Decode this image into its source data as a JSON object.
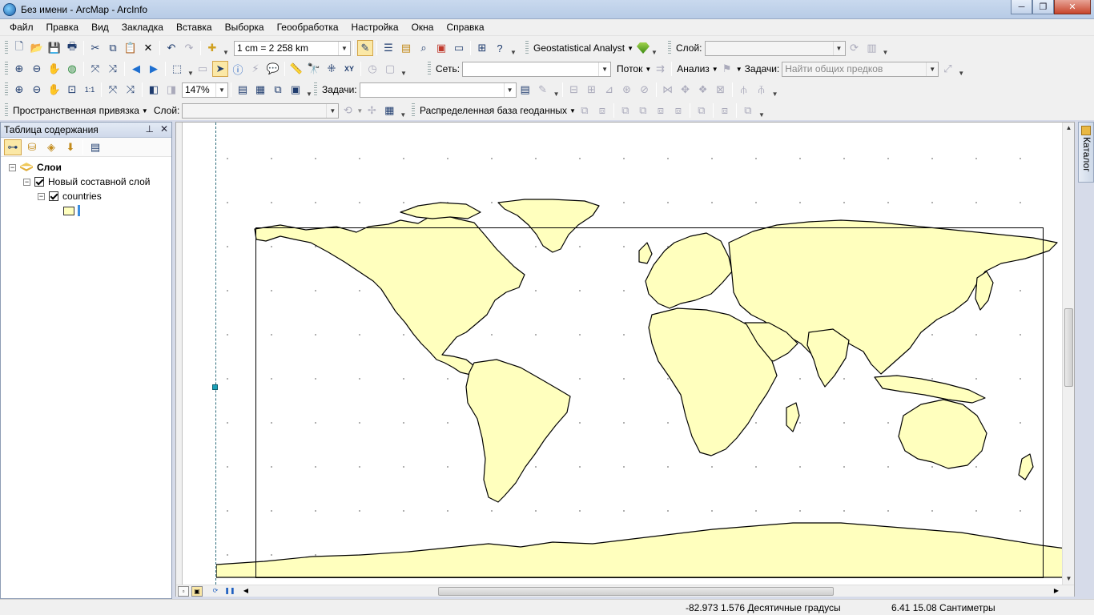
{
  "window": {
    "title": "Без имени - ArcMap - ArcInfo",
    "minimize": "─",
    "maximize": "❐",
    "close": "✕"
  },
  "menu": [
    "Файл",
    "Правка",
    "Вид",
    "Закладка",
    "Вставка",
    "Выборка",
    "Геообработка",
    "Настройка",
    "Окна",
    "Справка"
  ],
  "toolbar": {
    "scale_value": "1 cm = 2 258 km",
    "geostat_label": "Geostatistical Analyst",
    "layer_label": "Слой:",
    "network_label": "Сеть:",
    "flow_label": "Поток",
    "analysis_label": "Анализ",
    "tasks_label": "Задачи:",
    "tasks_value": "Найти общих предков",
    "zoom_value": "147%",
    "tasks2_label": "Задачи:",
    "georef_label": "Пространственная привязка",
    "layer2_label": "Слой:",
    "distributed_label": "Распределенная база геоданных"
  },
  "toc": {
    "title": "Таблица содержания",
    "pin": "⊥",
    "close": "✕",
    "root_label": "Слои",
    "group_label": "Новый составной слой",
    "layer_label": "countries",
    "expander_symbol": "−"
  },
  "catalog": {
    "label": "Каталог"
  },
  "status": {
    "coords": "-82.973  1.576 Десятичные градусы",
    "page": "6.41  15.08 Сантиметры"
  },
  "colors": {
    "land_fill": "#ffffbe",
    "land_stroke": "#000000",
    "accent": "#3c8ee0"
  }
}
